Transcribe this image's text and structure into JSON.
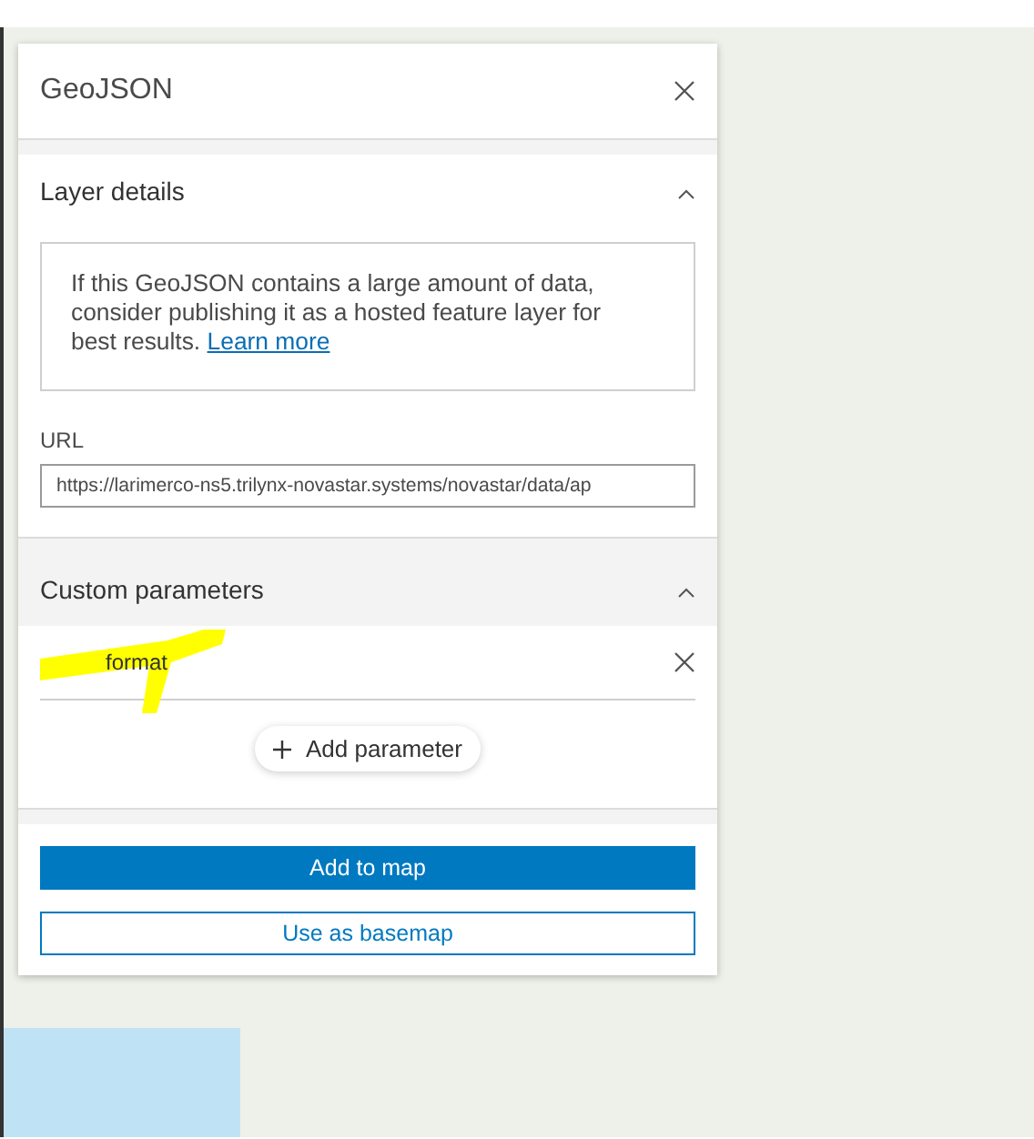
{
  "panel": {
    "title": "GeoJSON",
    "layer_details": {
      "heading": "Layer details",
      "expanded": true,
      "notice": "If this GeoJSON contains a large amount of data, consider publishing it as a hosted feature layer for best results.",
      "link": "Learn more",
      "url_label": "URL",
      "url_value": "https://larimerco-ns5.trilynx-novastar.systems/novastar/data/ap"
    },
    "custom_parameters": {
      "heading": "Custom parameters",
      "expanded": true,
      "parameters": [
        {
          "name": "format"
        }
      ],
      "add_button": "Add parameter"
    },
    "buttons": [
      {
        "label": "Add to map",
        "kind": "primary"
      },
      {
        "label": "Use as basemap",
        "kind": "outline"
      }
    ]
  }
}
